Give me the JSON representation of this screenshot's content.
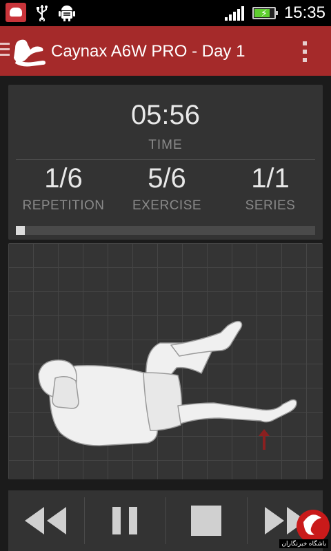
{
  "status_bar": {
    "time": "15:35",
    "icons": [
      "app-notification-icon",
      "usb-icon",
      "android-debug-icon",
      "signal-icon",
      "battery-charging-icon"
    ],
    "battery_level": 0.8,
    "signal_level": 1.0
  },
  "action_bar": {
    "title": "Caynax A6W PRO - Day 1",
    "overflow_icon": "overflow-menu-icon",
    "logo_icon": "exercise-logo-icon"
  },
  "stats": {
    "time": {
      "value": "05:56",
      "label": "TIME"
    },
    "repetition": {
      "value": "1/6",
      "label": "REPETITION"
    },
    "exercise": {
      "value": "5/6",
      "label": "EXERCISE"
    },
    "series": {
      "value": "1/1",
      "label": "SERIES"
    },
    "progress": 0.03
  },
  "controls": {
    "rewind_icon": "rewind-icon",
    "pause_icon": "pause-icon",
    "stop_icon": "stop-icon",
    "forward_icon": "fast-forward-icon"
  },
  "watermark": {
    "text": "باشگاه خبرنگاران"
  },
  "colors": {
    "action_bar": "#a52a2a",
    "panel": "#333333",
    "accent_arrow": "#8b2020",
    "battery_fill": "#5fcf2f"
  }
}
